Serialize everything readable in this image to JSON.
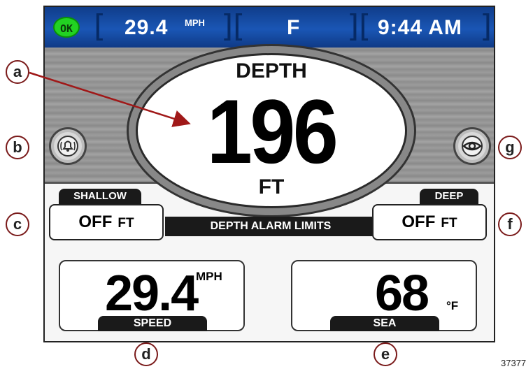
{
  "status_bar": {
    "ok_badge": "OK",
    "speed_value": "29.4",
    "speed_unit": "MPH",
    "heading": "F",
    "time": "9:44 AM"
  },
  "depth_display": {
    "title": "DEPTH",
    "value": "196",
    "unit": "FT"
  },
  "alarm_limits": {
    "label": "DEPTH ALARM LIMITS",
    "shallow": {
      "tab": "SHALLOW",
      "value": "OFF",
      "unit": "FT"
    },
    "deep": {
      "tab": "DEEP",
      "value": "OFF",
      "unit": "FT"
    }
  },
  "gauges": {
    "speed": {
      "value": "29.4",
      "unit": "MPH",
      "label": "SPEED"
    },
    "sea": {
      "value": "68",
      "unit": "°F",
      "label": "SEA"
    }
  },
  "buttons": {
    "left_icon": "alarm-bell-icon",
    "right_icon": "eye-icon"
  },
  "callouts": [
    "a",
    "b",
    "c",
    "d",
    "e",
    "f",
    "g"
  ],
  "figure_code": "37377",
  "colors": {
    "status_bar": "#1a56b5",
    "ok_green": "#22d222",
    "label_dark": "#1a1a1a",
    "callout_border": "#7a1a1a",
    "arrow": "#a01818"
  }
}
